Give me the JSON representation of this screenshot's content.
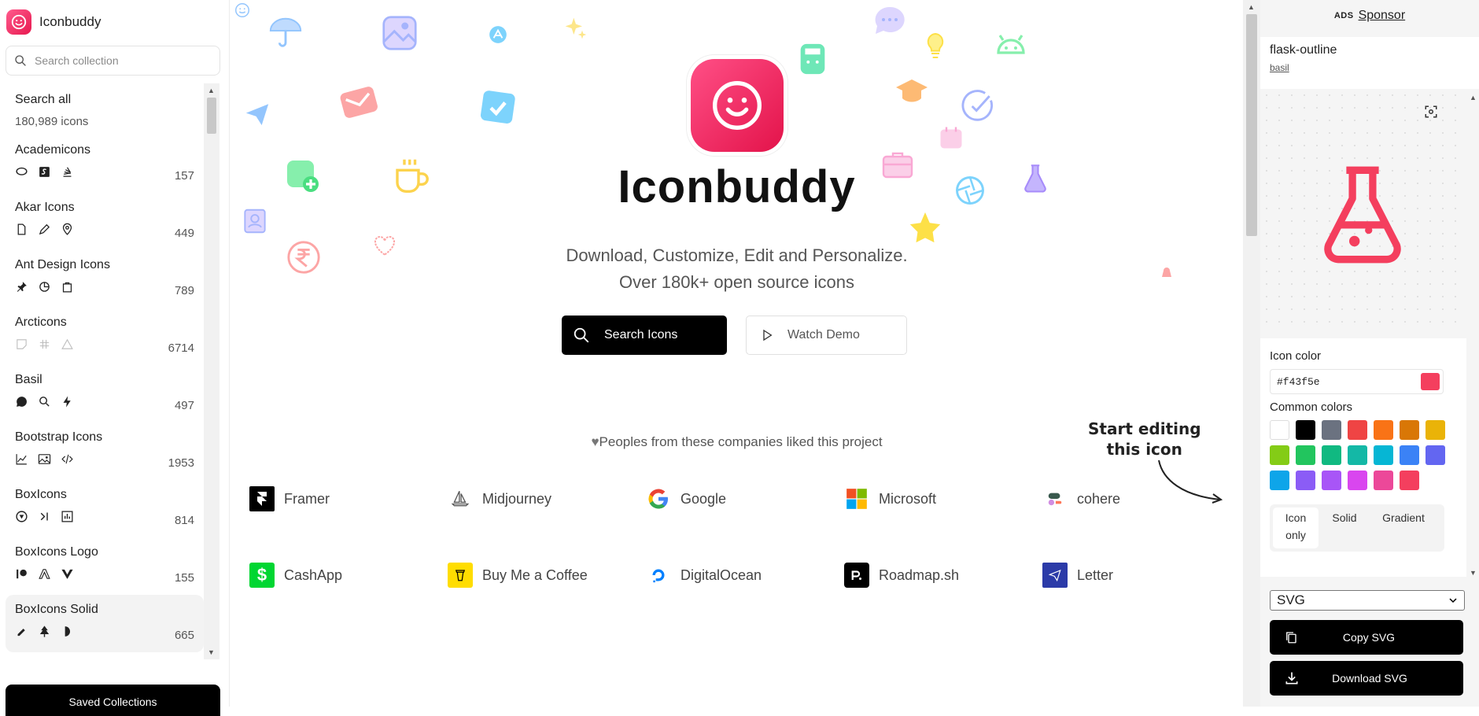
{
  "app": {
    "name": "Iconbuddy"
  },
  "sidebar": {
    "search_placeholder": "Search collection",
    "search_all": {
      "label": "Search all",
      "count": "180,989 icons"
    },
    "collections": [
      {
        "name": "Academicons",
        "count": "157"
      },
      {
        "name": "Akar Icons",
        "count": "449"
      },
      {
        "name": "Ant Design Icons",
        "count": "789"
      },
      {
        "name": "Arcticons",
        "count": "6714"
      },
      {
        "name": "Basil",
        "count": "497"
      },
      {
        "name": "Bootstrap Icons",
        "count": "1953"
      },
      {
        "name": "BoxIcons",
        "count": "814"
      },
      {
        "name": "BoxIcons Logo",
        "count": "155"
      },
      {
        "name": "BoxIcons Solid",
        "count": "665"
      }
    ],
    "saved_label": "Saved Collections"
  },
  "hero": {
    "title": "Iconbuddy",
    "subtitle_line1": "Download, Customize, Edit and Personalize.",
    "subtitle_line2": "Over 180k+ open source icons",
    "search_button": "Search Icons",
    "demo_button": "Watch Demo"
  },
  "companies": {
    "heading": "Peoples from these companies liked this project",
    "items": [
      "Framer",
      "Midjourney",
      "Google",
      "Microsoft",
      "cohere",
      "CashApp",
      "Buy Me a Coffee",
      "DigitalOcean",
      "Roadmap.sh",
      "Letter"
    ]
  },
  "annotation": {
    "line1": "Start editing",
    "line2": "this icon"
  },
  "right_panel": {
    "ads_tag": "ADS",
    "sponsor_label": "Sponsor",
    "icon_name": "flask-outline",
    "icon_set": "basil",
    "icon_color_label": "Icon color",
    "icon_color_value": "#f43f5e",
    "common_colors_label": "Common colors",
    "common_colors": [
      "#ffffff",
      "#000000",
      "#6b7280",
      "#ef4444",
      "#f97316",
      "#d97706",
      "#eab308",
      "#84cc16",
      "#22c55e",
      "#10b981",
      "#14b8a6",
      "#06b6d4",
      "#3b82f6",
      "#6366f1",
      "#0ea5e9",
      "#8b5cf6",
      "#a855f7",
      "#d946ef",
      "#ec4899",
      "#f43f5e"
    ],
    "tabs": {
      "icon_only_1": "Icon",
      "icon_only_2": "only",
      "solid": "Solid",
      "gradient": "Gradient"
    },
    "format": "SVG",
    "copy_button": "Copy SVG",
    "download_button": "Download  SVG"
  },
  "colors": {
    "brand": "#f43f5e",
    "accent": "#000000"
  }
}
